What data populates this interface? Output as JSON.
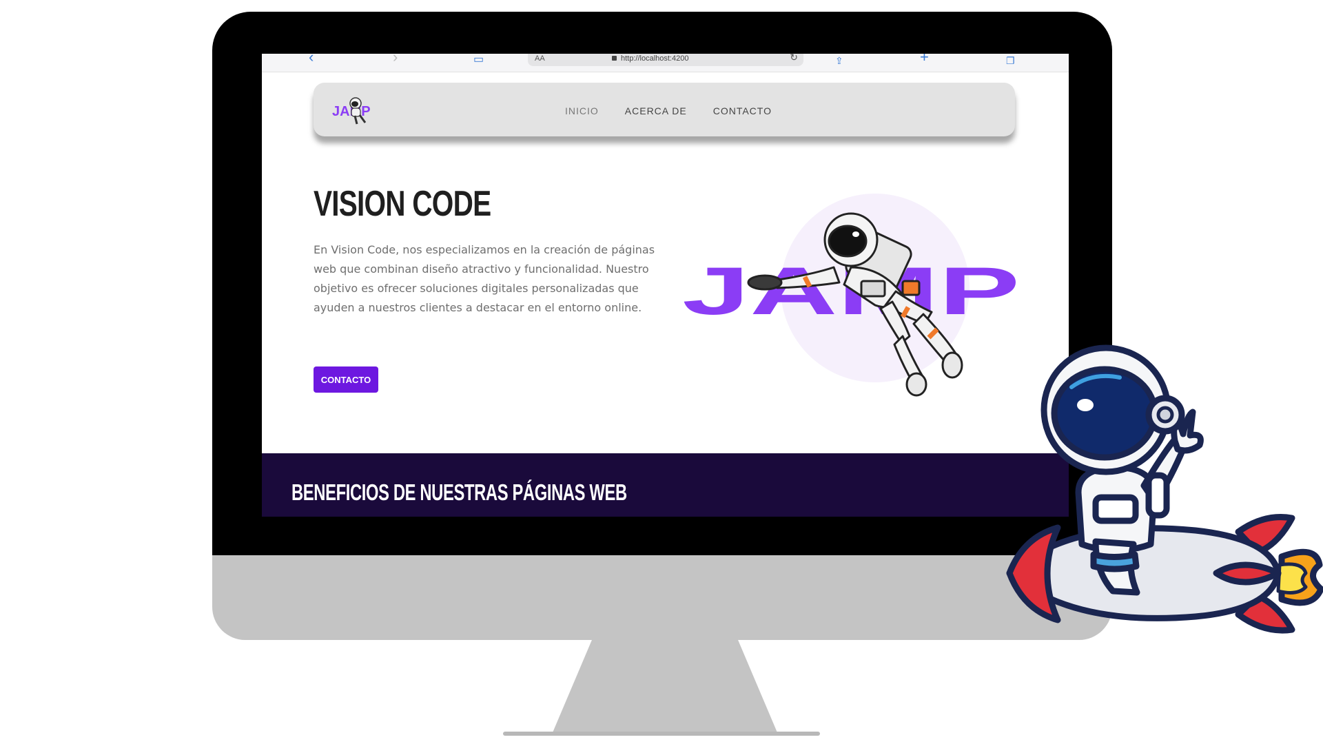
{
  "browser": {
    "url": "http://localhost:4200",
    "reader_label": "AA",
    "icons": [
      "back-icon",
      "forward-icon",
      "bookmarks-icon",
      "lock-icon",
      "reload-icon",
      "share-icon",
      "new-tab-icon",
      "tabs-icon"
    ]
  },
  "navbar": {
    "logo_text": "JAMP",
    "links": [
      "INICIO",
      "ACERCA DE",
      "CONTACTO"
    ]
  },
  "hero": {
    "title": "VISION CODE",
    "description": "En Vision Code, nos especializamos en la creación de páginas web que combinan diseño atractivo y funcionalidad. Nuestro objetivo es ofrecer soluciones digitales personalizadas que ayuden a nuestros clientes a destacar en el entorno online.",
    "button_label": "CONTACTO",
    "art_word": "JAMP"
  },
  "benefits": {
    "title": "BENEFICIOS DE NUESTRAS PÁGINAS WEB"
  },
  "colors": {
    "accent": "#6d18e0",
    "brand_word": "#8b3df5",
    "band": "#1a0a3b",
    "rocket_red": "#e2303a",
    "helmet_blue": "#102a6b"
  }
}
